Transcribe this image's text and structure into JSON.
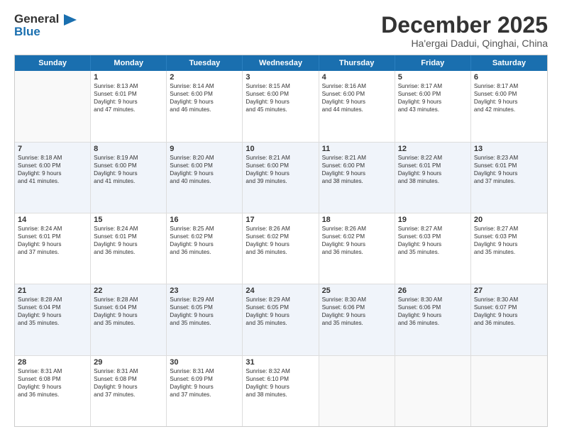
{
  "header": {
    "logo_line1": "General",
    "logo_line2": "Blue",
    "title": "December 2025",
    "subtitle": "Ha'ergai Dadui, Qinghai, China"
  },
  "calendar": {
    "days_of_week": [
      "Sunday",
      "Monday",
      "Tuesday",
      "Wednesday",
      "Thursday",
      "Friday",
      "Saturday"
    ],
    "rows": [
      {
        "alt": false,
        "cells": [
          {
            "day": "",
            "lines": []
          },
          {
            "day": "1",
            "lines": [
              "Sunrise: 8:13 AM",
              "Sunset: 6:01 PM",
              "Daylight: 9 hours",
              "and 47 minutes."
            ]
          },
          {
            "day": "2",
            "lines": [
              "Sunrise: 8:14 AM",
              "Sunset: 6:00 PM",
              "Daylight: 9 hours",
              "and 46 minutes."
            ]
          },
          {
            "day": "3",
            "lines": [
              "Sunrise: 8:15 AM",
              "Sunset: 6:00 PM",
              "Daylight: 9 hours",
              "and 45 minutes."
            ]
          },
          {
            "day": "4",
            "lines": [
              "Sunrise: 8:16 AM",
              "Sunset: 6:00 PM",
              "Daylight: 9 hours",
              "and 44 minutes."
            ]
          },
          {
            "day": "5",
            "lines": [
              "Sunrise: 8:17 AM",
              "Sunset: 6:00 PM",
              "Daylight: 9 hours",
              "and 43 minutes."
            ]
          },
          {
            "day": "6",
            "lines": [
              "Sunrise: 8:17 AM",
              "Sunset: 6:00 PM",
              "Daylight: 9 hours",
              "and 42 minutes."
            ]
          }
        ]
      },
      {
        "alt": true,
        "cells": [
          {
            "day": "7",
            "lines": [
              "Sunrise: 8:18 AM",
              "Sunset: 6:00 PM",
              "Daylight: 9 hours",
              "and 41 minutes."
            ]
          },
          {
            "day": "8",
            "lines": [
              "Sunrise: 8:19 AM",
              "Sunset: 6:00 PM",
              "Daylight: 9 hours",
              "and 41 minutes."
            ]
          },
          {
            "day": "9",
            "lines": [
              "Sunrise: 8:20 AM",
              "Sunset: 6:00 PM",
              "Daylight: 9 hours",
              "and 40 minutes."
            ]
          },
          {
            "day": "10",
            "lines": [
              "Sunrise: 8:21 AM",
              "Sunset: 6:00 PM",
              "Daylight: 9 hours",
              "and 39 minutes."
            ]
          },
          {
            "day": "11",
            "lines": [
              "Sunrise: 8:21 AM",
              "Sunset: 6:00 PM",
              "Daylight: 9 hours",
              "and 38 minutes."
            ]
          },
          {
            "day": "12",
            "lines": [
              "Sunrise: 8:22 AM",
              "Sunset: 6:01 PM",
              "Daylight: 9 hours",
              "and 38 minutes."
            ]
          },
          {
            "day": "13",
            "lines": [
              "Sunrise: 8:23 AM",
              "Sunset: 6:01 PM",
              "Daylight: 9 hours",
              "and 37 minutes."
            ]
          }
        ]
      },
      {
        "alt": false,
        "cells": [
          {
            "day": "14",
            "lines": [
              "Sunrise: 8:24 AM",
              "Sunset: 6:01 PM",
              "Daylight: 9 hours",
              "and 37 minutes."
            ]
          },
          {
            "day": "15",
            "lines": [
              "Sunrise: 8:24 AM",
              "Sunset: 6:01 PM",
              "Daylight: 9 hours",
              "and 36 minutes."
            ]
          },
          {
            "day": "16",
            "lines": [
              "Sunrise: 8:25 AM",
              "Sunset: 6:02 PM",
              "Daylight: 9 hours",
              "and 36 minutes."
            ]
          },
          {
            "day": "17",
            "lines": [
              "Sunrise: 8:26 AM",
              "Sunset: 6:02 PM",
              "Daylight: 9 hours",
              "and 36 minutes."
            ]
          },
          {
            "day": "18",
            "lines": [
              "Sunrise: 8:26 AM",
              "Sunset: 6:02 PM",
              "Daylight: 9 hours",
              "and 36 minutes."
            ]
          },
          {
            "day": "19",
            "lines": [
              "Sunrise: 8:27 AM",
              "Sunset: 6:03 PM",
              "Daylight: 9 hours",
              "and 35 minutes."
            ]
          },
          {
            "day": "20",
            "lines": [
              "Sunrise: 8:27 AM",
              "Sunset: 6:03 PM",
              "Daylight: 9 hours",
              "and 35 minutes."
            ]
          }
        ]
      },
      {
        "alt": true,
        "cells": [
          {
            "day": "21",
            "lines": [
              "Sunrise: 8:28 AM",
              "Sunset: 6:04 PM",
              "Daylight: 9 hours",
              "and 35 minutes."
            ]
          },
          {
            "day": "22",
            "lines": [
              "Sunrise: 8:28 AM",
              "Sunset: 6:04 PM",
              "Daylight: 9 hours",
              "and 35 minutes."
            ]
          },
          {
            "day": "23",
            "lines": [
              "Sunrise: 8:29 AM",
              "Sunset: 6:05 PM",
              "Daylight: 9 hours",
              "and 35 minutes."
            ]
          },
          {
            "day": "24",
            "lines": [
              "Sunrise: 8:29 AM",
              "Sunset: 6:05 PM",
              "Daylight: 9 hours",
              "and 35 minutes."
            ]
          },
          {
            "day": "25",
            "lines": [
              "Sunrise: 8:30 AM",
              "Sunset: 6:06 PM",
              "Daylight: 9 hours",
              "and 35 minutes."
            ]
          },
          {
            "day": "26",
            "lines": [
              "Sunrise: 8:30 AM",
              "Sunset: 6:06 PM",
              "Daylight: 9 hours",
              "and 36 minutes."
            ]
          },
          {
            "day": "27",
            "lines": [
              "Sunrise: 8:30 AM",
              "Sunset: 6:07 PM",
              "Daylight: 9 hours",
              "and 36 minutes."
            ]
          }
        ]
      },
      {
        "alt": false,
        "cells": [
          {
            "day": "28",
            "lines": [
              "Sunrise: 8:31 AM",
              "Sunset: 6:08 PM",
              "Daylight: 9 hours",
              "and 36 minutes."
            ]
          },
          {
            "day": "29",
            "lines": [
              "Sunrise: 8:31 AM",
              "Sunset: 6:08 PM",
              "Daylight: 9 hours",
              "and 37 minutes."
            ]
          },
          {
            "day": "30",
            "lines": [
              "Sunrise: 8:31 AM",
              "Sunset: 6:09 PM",
              "Daylight: 9 hours",
              "and 37 minutes."
            ]
          },
          {
            "day": "31",
            "lines": [
              "Sunrise: 8:32 AM",
              "Sunset: 6:10 PM",
              "Daylight: 9 hours",
              "and 38 minutes."
            ]
          },
          {
            "day": "",
            "lines": []
          },
          {
            "day": "",
            "lines": []
          },
          {
            "day": "",
            "lines": []
          }
        ]
      }
    ]
  }
}
